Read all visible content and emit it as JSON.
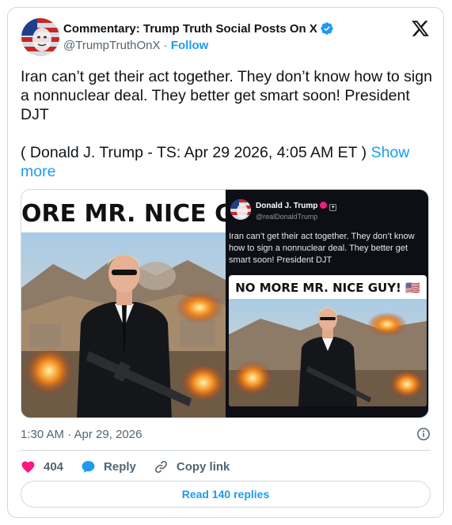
{
  "header": {
    "display_name": "Commentary: Trump Truth Social Posts On X",
    "handle": "@TrumpTruthOnX",
    "separator": "·",
    "follow_label": "Follow"
  },
  "tweet": {
    "line1": "Iran can’t get their act together. They don’t know how to sign a nonnuclear deal. They better get smart soon! President DJT",
    "line2": "( Donald J. Trump - TS: Apr 29 2026, 4:05 AM ET )",
    "show_more": "Show more"
  },
  "media": {
    "left_banner": "ORE MR. NICE GU",
    "embed": {
      "name": "Donald J. Trump",
      "handle": "@realDonaldTrump",
      "text": "Iran can’t get their act together. They don’t know how to sign a nonnuclear deal. They better get smart soon! President DJT",
      "plus": "+",
      "banner": "NO MORE MR. NICE GUY! 🇺🇸"
    }
  },
  "footer": {
    "timestamp": "1:30 AM · Apr 29, 2026",
    "like_count": "404",
    "reply_label": "Reply",
    "copy_link_label": "Copy link",
    "read_replies_label": "Read 140 replies"
  },
  "colors": {
    "accent": "#1d9bf0",
    "like": "#f91880",
    "muted": "#536471",
    "border": "#cfd9de"
  },
  "icons": {
    "verified": "verified-badge-icon",
    "x_logo": "x-logo-icon",
    "info": "info-icon",
    "like": "heart-icon",
    "reply": "speech-bubble-icon",
    "copy_link": "link-icon"
  }
}
